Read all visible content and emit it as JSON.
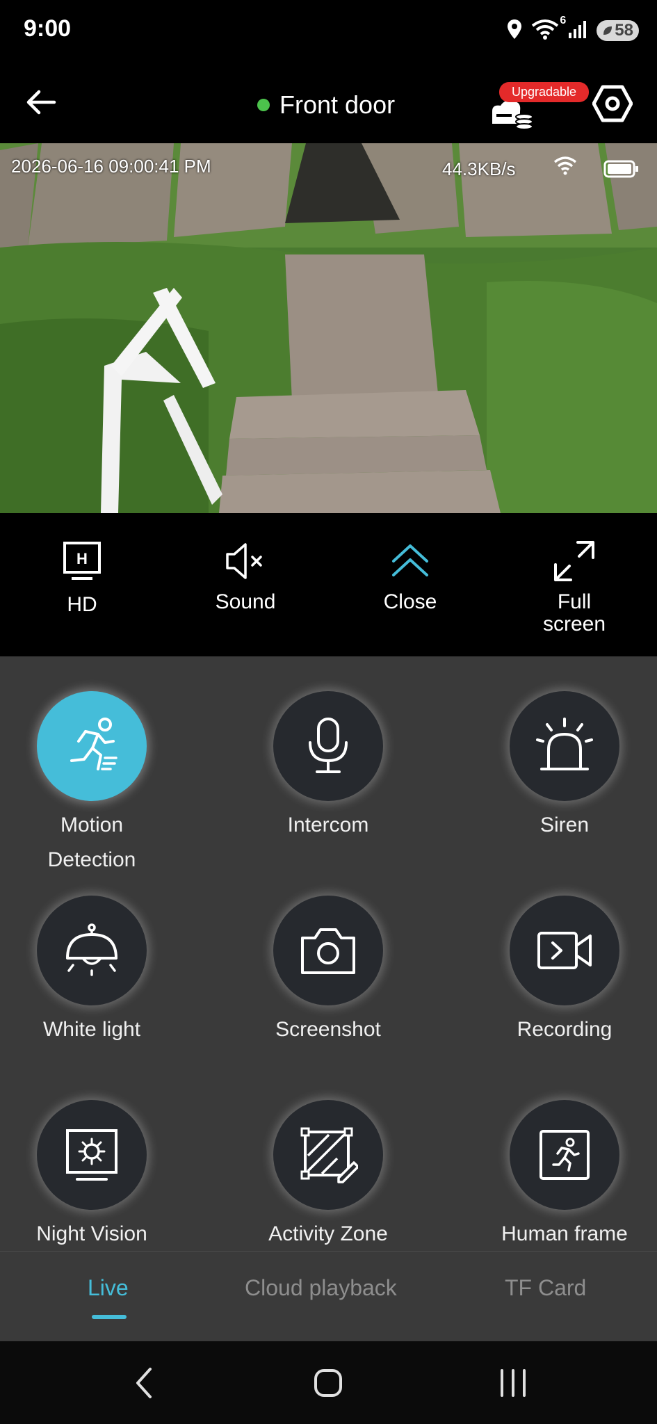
{
  "status_bar": {
    "time": "9:00",
    "wifi_badge": "6",
    "battery_level": "58",
    "icons": [
      "location-icon",
      "wifi-icon",
      "signal-icon",
      "battery-icon"
    ]
  },
  "app_bar": {
    "title": "Front door",
    "online_color": "#4cc24c",
    "upgrade_badge": "Upgradable",
    "icons": [
      "back-arrow-icon",
      "cloud-storage-icon",
      "settings-icon"
    ]
  },
  "video": {
    "timestamp": "2026-06-16 09:00:41 PM",
    "data_rate": "44.3KB/s",
    "icons": [
      "wifi-icon",
      "battery-icon"
    ]
  },
  "controls": [
    {
      "label": "HD",
      "icon": "hd-icon"
    },
    {
      "label": "Sound",
      "icon": "speaker-muted-icon"
    },
    {
      "label": "Close",
      "icon": "chevron-up-icon"
    },
    {
      "label": "Full screen",
      "icon": "fullscreen-icon"
    }
  ],
  "features": [
    {
      "label": "Motion Detection",
      "icon": "running-person-icon",
      "active": true
    },
    {
      "label": "Intercom",
      "icon": "microphone-icon",
      "active": false
    },
    {
      "label": "Siren",
      "icon": "siren-icon",
      "active": false
    },
    {
      "label": "White light",
      "icon": "ceiling-light-icon",
      "active": false
    },
    {
      "label": "Screenshot",
      "icon": "camera-icon",
      "active": false
    },
    {
      "label": "Recording",
      "icon": "video-record-icon",
      "active": false
    },
    {
      "label": "Night Vision",
      "icon": "night-vision-icon",
      "active": false
    },
    {
      "label": "Activity Zone",
      "icon": "zone-edit-icon",
      "active": false
    },
    {
      "label": "Human frame",
      "icon": "human-frame-icon",
      "active": false
    }
  ],
  "tabs": [
    {
      "label": "Live",
      "active": true
    },
    {
      "label": "Cloud playback",
      "active": false
    },
    {
      "label": "TF Card",
      "active": false
    }
  ],
  "colors": {
    "accent": "#45bdd9",
    "badge": "#e42a2a"
  },
  "nav": [
    "back-icon",
    "home-icon",
    "recents-icon"
  ]
}
